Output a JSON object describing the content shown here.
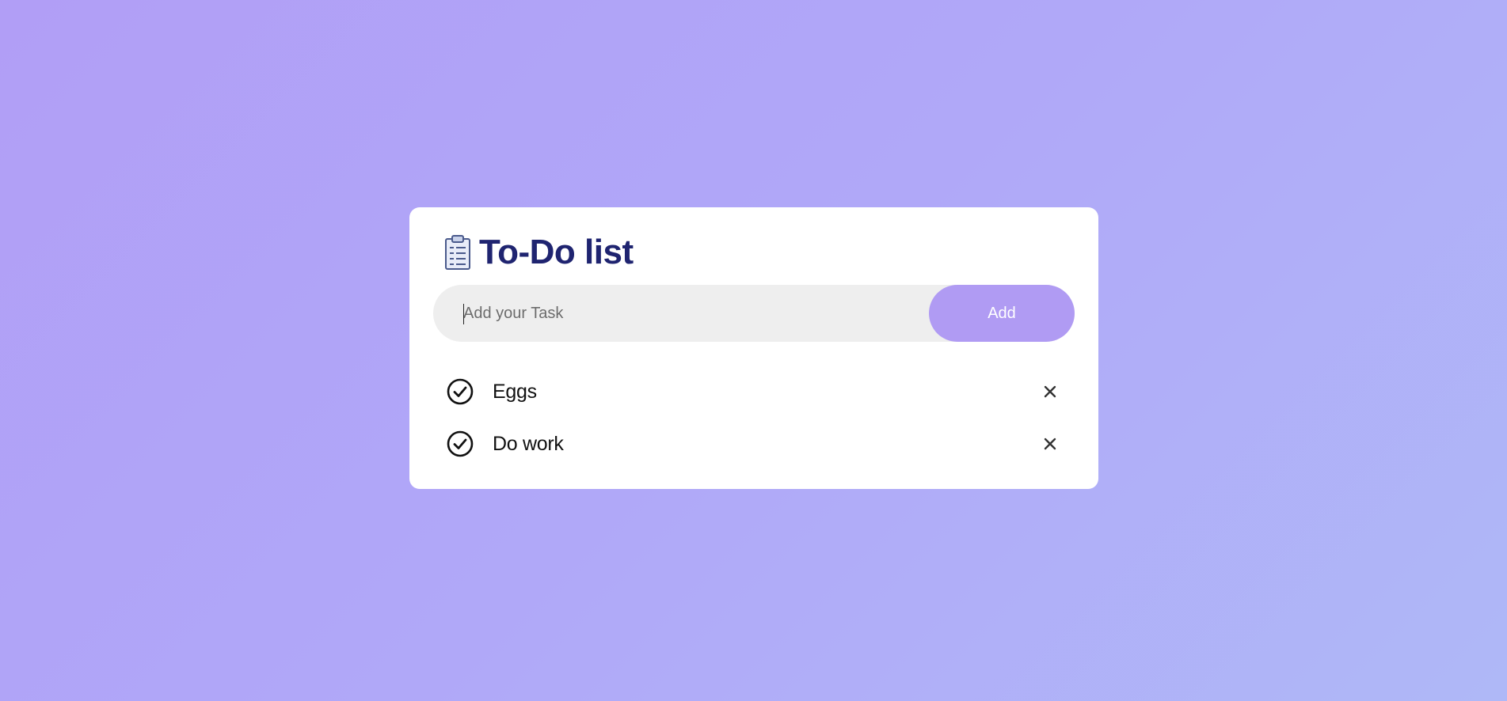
{
  "app": {
    "title": "To-Do list",
    "icon": "clipboard-icon"
  },
  "input": {
    "placeholder": "Add your Task",
    "value": ""
  },
  "add_button": {
    "label": "Add"
  },
  "tasks": [
    {
      "label": "Eggs",
      "checked": true,
      "check_icon": "check-circle-icon",
      "delete_icon": "close-icon"
    },
    {
      "label": "Do work",
      "checked": true,
      "check_icon": "check-circle-icon",
      "delete_icon": "close-icon"
    }
  ],
  "colors": {
    "title": "#1f2470",
    "accent": "#b09bf3",
    "input_bg": "#eeeeee",
    "card_bg": "#ffffff"
  }
}
